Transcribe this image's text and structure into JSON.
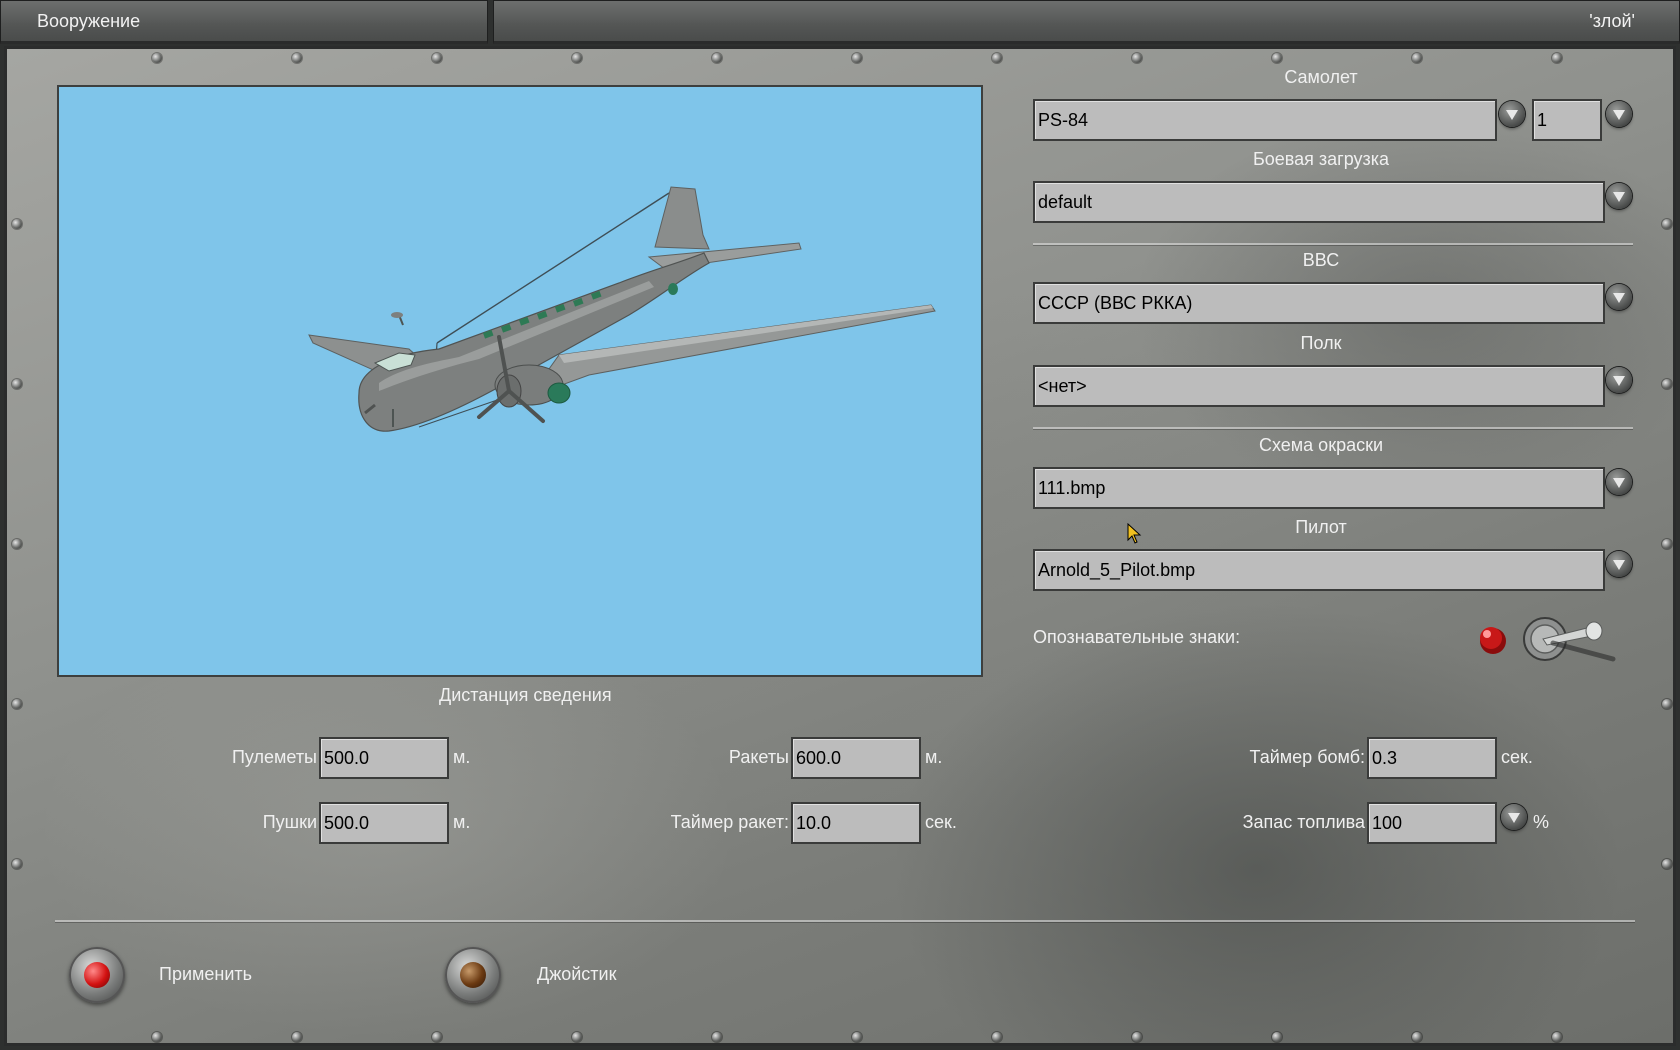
{
  "window": {
    "title": "Вооружение",
    "user": "'злой'"
  },
  "aircraft": {
    "label": "Самолет",
    "value": "PS-84",
    "count": "1"
  },
  "loadout": {
    "label": "Боевая загрузка",
    "value": "default"
  },
  "airforce": {
    "label": "ВВС",
    "value": "СССР (ВВС РККА)"
  },
  "regiment": {
    "label": "Полк",
    "value": "<нет>"
  },
  "skin": {
    "label": "Схема окраски",
    "value": "111.bmp"
  },
  "pilot": {
    "label": "Пилот",
    "value": "Arnold_5_Pilot.bmp"
  },
  "markings": {
    "label": "Опознавательные знаки:"
  },
  "convergence": {
    "title": "Дистанция сведения",
    "guns_label": "Пулеметы",
    "guns_value": "500.0",
    "guns_unit": "м.",
    "cannons_label": "Пушки",
    "cannons_value": "500.0",
    "cannons_unit": "м.",
    "rockets_label": "Ракеты",
    "rockets_value": "600.0",
    "rockets_unit": "м.",
    "rocket_timer_label": "Таймер ракет:",
    "rocket_timer_value": "10.0",
    "rocket_timer_unit": "сек.",
    "bomb_timer_label": "Таймер бомб:",
    "bomb_timer_value": "0.3",
    "bomb_timer_unit": "сек.",
    "fuel_label": "Запас топлива",
    "fuel_value": "100",
    "fuel_unit": "%"
  },
  "buttons": {
    "apply": "Применить",
    "joystick": "Джойстик"
  },
  "colors": {
    "sky": "#7fc5ea",
    "led_red": "#d31212",
    "led_brown": "#6b3a12"
  },
  "icons": [
    "dropdown-arrow-icon",
    "toggle-switch-icon",
    "red-indicator-icon",
    "mouse-cursor-icon",
    "rivet-icon"
  ]
}
